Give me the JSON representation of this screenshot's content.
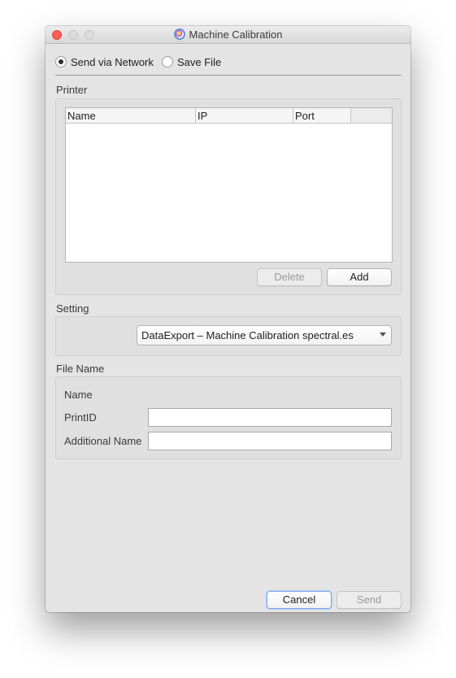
{
  "window": {
    "title": "Machine Calibration",
    "icon": "app-icon"
  },
  "output_mode": {
    "options": [
      {
        "label": "Send via Network",
        "selected": true
      },
      {
        "label": "Save File",
        "selected": false
      }
    ]
  },
  "printer": {
    "label": "Printer",
    "table": {
      "columns": [
        "Name",
        "IP",
        "Port"
      ],
      "rows": []
    },
    "delete_label": "Delete",
    "add_label": "Add"
  },
  "setting": {
    "label": "Setting",
    "selected_value": "DataExport – Machine Calibration spectral.es"
  },
  "file_name": {
    "label": "File Name",
    "name_label": "Name",
    "print_id_label": "PrintID",
    "print_id_value": "",
    "additional_name_label": "Additional Name",
    "additional_name_value": ""
  },
  "footer": {
    "cancel_label": "Cancel",
    "send_label": "Send"
  },
  "colors": {
    "close_button": "#fc5f57",
    "window_background": "#e4e4e4",
    "default_button_focus": "#7aa7ea"
  }
}
